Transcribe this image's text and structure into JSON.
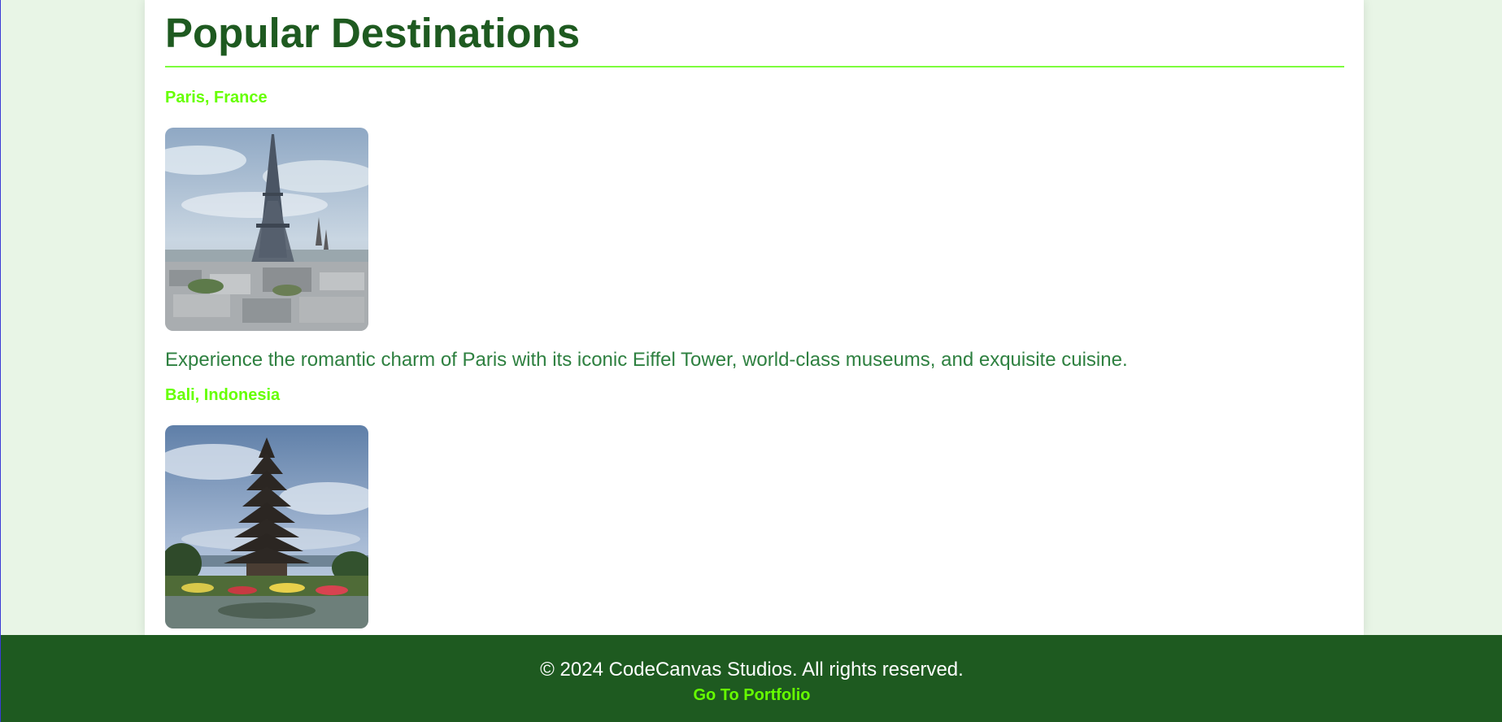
{
  "page": {
    "title": "Popular Destinations"
  },
  "destinations": [
    {
      "name": "Paris, France",
      "image_subject": "eiffel-tower-photo",
      "description": "Experience the romantic charm of Paris with its iconic Eiffel Tower, world-class museums, and exquisite cuisine."
    },
    {
      "name": "Bali, Indonesia",
      "image_subject": "bali-temple-photo",
      "description": ""
    }
  ],
  "footer": {
    "copyright": "© 2024 CodeCanvas Studios. All rights reserved.",
    "link_label": "Go To Portfolio"
  },
  "colors": {
    "page_background": "#e8f5e6",
    "title": "#1e5a20",
    "accent": "#66ff00",
    "description_text": "#2e8040",
    "footer_background": "#1e5a20"
  }
}
